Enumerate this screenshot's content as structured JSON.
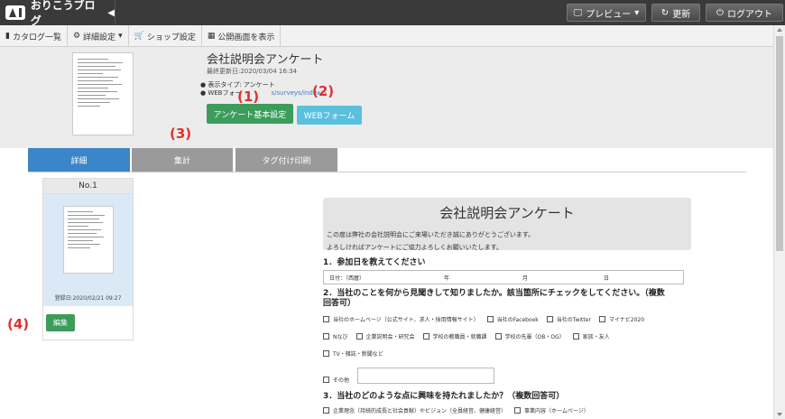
{
  "topbar": {
    "brand": "おりこうブログ",
    "preview_label": "プレビュー",
    "refresh_label": "更新",
    "logout_label": "ログアウト"
  },
  "subnav": {
    "items": [
      "カタログ一覧",
      "詳細設定",
      "ショップ設定",
      "公開画面を表示"
    ]
  },
  "header": {
    "title": "会社説明会アンケート",
    "updated": "最終更新日:2020/03/04 16:34",
    "display_type": "● 表示タイプ: アンケート",
    "web_form_prefix": "● WEBフォー",
    "web_form_url": "s/surveys/index/5",
    "btn_basic": "アンケート基本設定",
    "btn_webform": "WEBフォーム"
  },
  "markers": {
    "m1": "(1)",
    "m2": "(2)",
    "m3": "(3)",
    "m4": "(4)"
  },
  "tabs": [
    "詳細",
    "集計",
    "タグ付け印刷"
  ],
  "card": {
    "number": "No.1",
    "date": "登録日:2020/02/21 09:27",
    "edit": "編集"
  },
  "survey": {
    "title": "会社説明会アンケート",
    "desc1": "この度は弊社の会社説明会にご来場いただき誠にありがとうございます。",
    "desc2": "よろしければアンケートにご協力よろしくお願いいたします。",
    "q1": "1．参加日を教えてください",
    "date_label": "日付：（西暦）",
    "year": "年",
    "month": "月",
    "day": "日",
    "q2a": "2．当社のことを何から見聞きして知りましたか。該当箇所にチェックをしてください。（複数",
    "q2b": "回答可）",
    "row1": [
      "当社のホームページ（公式サイト、求人・採用情報サイト）",
      "当社のFacebook",
      "当社のTwitter",
      "マイナビ2020"
    ],
    "row2": [
      "Nなび",
      "企業説明会・研究会",
      "学校の教職員・就職課",
      "学校の先輩（OB・OG）",
      "家族・友人"
    ],
    "row3": [
      "TV・雑誌・新聞など"
    ],
    "other": "その他",
    "q3": "3．当社のどのような点に興味を持たれましたか？（複数回答可）",
    "row4": [
      "企業理念（持続的成長と社会貢献）やビジョン（全員経営、健康経営）",
      "事業内容（ホームページ）"
    ]
  }
}
